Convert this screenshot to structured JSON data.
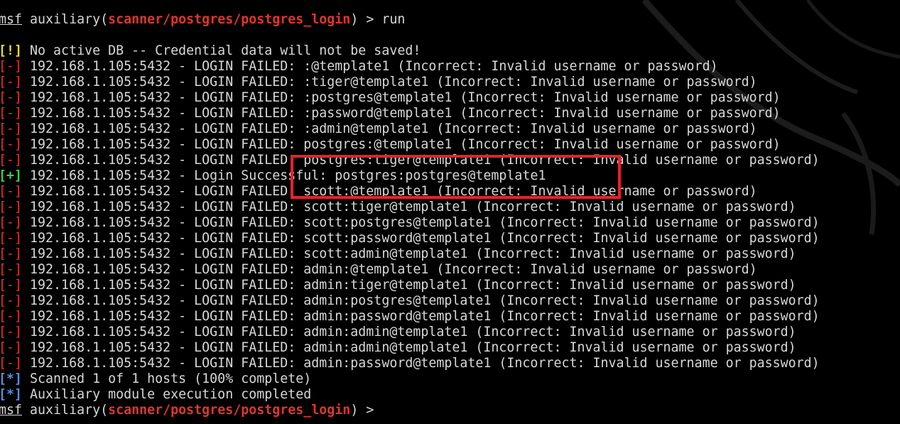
{
  "prompt": {
    "msf": "msf",
    "module_prefix": " auxiliary(",
    "module": "scanner/postgres/postgres_login",
    "module_suffix": ") > ",
    "command": "run"
  },
  "lines": [
    {
      "tag": "[!]",
      "kind": "warn",
      "text": " No active DB -- Credential data will not be saved!"
    },
    {
      "tag": "[-]",
      "kind": "fail",
      "text": " 192.168.1.105:5432 - LOGIN FAILED: :@template1 (Incorrect: Invalid username or password)"
    },
    {
      "tag": "[-]",
      "kind": "fail",
      "text": " 192.168.1.105:5432 - LOGIN FAILED: :tiger@template1 (Incorrect: Invalid username or password)"
    },
    {
      "tag": "[-]",
      "kind": "fail",
      "text": " 192.168.1.105:5432 - LOGIN FAILED: :postgres@template1 (Incorrect: Invalid username or password)"
    },
    {
      "tag": "[-]",
      "kind": "fail",
      "text": " 192.168.1.105:5432 - LOGIN FAILED: :password@template1 (Incorrect: Invalid username or password)"
    },
    {
      "tag": "[-]",
      "kind": "fail",
      "text": " 192.168.1.105:5432 - LOGIN FAILED: :admin@template1 (Incorrect: Invalid username or password)"
    },
    {
      "tag": "[-]",
      "kind": "fail",
      "text": " 192.168.1.105:5432 - LOGIN FAILED: postgres:@template1 (Incorrect: Invalid username or password)"
    },
    {
      "tag": "[-]",
      "kind": "fail",
      "text": " 192.168.1.105:5432 - LOGIN FAILED: postgres:tiger@template1 (Incorrect: Invalid username or password)"
    },
    {
      "tag": "[+]",
      "kind": "ok",
      "text": " 192.168.1.105:5432 - Login Successful: postgres:postgres@template1"
    },
    {
      "tag": "[-]",
      "kind": "fail",
      "text": " 192.168.1.105:5432 - LOGIN FAILED: scott:@template1 (Incorrect: Invalid username or password)"
    },
    {
      "tag": "[-]",
      "kind": "fail",
      "text": " 192.168.1.105:5432 - LOGIN FAILED: scott:tiger@template1 (Incorrect: Invalid username or password)"
    },
    {
      "tag": "[-]",
      "kind": "fail",
      "text": " 192.168.1.105:5432 - LOGIN FAILED: scott:postgres@template1 (Incorrect: Invalid username or password)"
    },
    {
      "tag": "[-]",
      "kind": "fail",
      "text": " 192.168.1.105:5432 - LOGIN FAILED: scott:password@template1 (Incorrect: Invalid username or password)"
    },
    {
      "tag": "[-]",
      "kind": "fail",
      "text": " 192.168.1.105:5432 - LOGIN FAILED: scott:admin@template1 (Incorrect: Invalid username or password)"
    },
    {
      "tag": "[-]",
      "kind": "fail",
      "text": " 192.168.1.105:5432 - LOGIN FAILED: admin:@template1 (Incorrect: Invalid username or password)"
    },
    {
      "tag": "[-]",
      "kind": "fail",
      "text": " 192.168.1.105:5432 - LOGIN FAILED: admin:tiger@template1 (Incorrect: Invalid username or password)"
    },
    {
      "tag": "[-]",
      "kind": "fail",
      "text": " 192.168.1.105:5432 - LOGIN FAILED: admin:postgres@template1 (Incorrect: Invalid username or password)"
    },
    {
      "tag": "[-]",
      "kind": "fail",
      "text": " 192.168.1.105:5432 - LOGIN FAILED: admin:password@template1 (Incorrect: Invalid username or password)"
    },
    {
      "tag": "[-]",
      "kind": "fail",
      "text": " 192.168.1.105:5432 - LOGIN FAILED: admin:admin@template1 (Incorrect: Invalid username or password)"
    },
    {
      "tag": "[-]",
      "kind": "fail",
      "text": " 192.168.1.105:5432 - LOGIN FAILED: admin:admin@template1 (Incorrect: Invalid username or password)"
    },
    {
      "tag": "[-]",
      "kind": "fail",
      "text": " 192.168.1.105:5432 - LOGIN FAILED: admin:password@template1 (Incorrect: Invalid username or password)"
    },
    {
      "tag": "[*]",
      "kind": "info",
      "text": " Scanned 1 of 1 hosts (100% complete)"
    },
    {
      "tag": "[*]",
      "kind": "info",
      "text": " Auxiliary module execution completed"
    }
  ],
  "final_prompt": {
    "msf": "msf",
    "module_prefix": " auxiliary(",
    "module": "scanner/postgres/postgres_login",
    "module_suffix": ") > "
  },
  "colors": {
    "background": "#000000",
    "text": "#d7d7d7",
    "module": "#e0362e",
    "warn": "#e6d93a",
    "fail": "#e0362e",
    "ok": "#4fc94f",
    "info": "#5b8ed6",
    "highlight_border": "#e0242a"
  },
  "icons": {
    "background_logo": "kali-dragon-icon"
  }
}
